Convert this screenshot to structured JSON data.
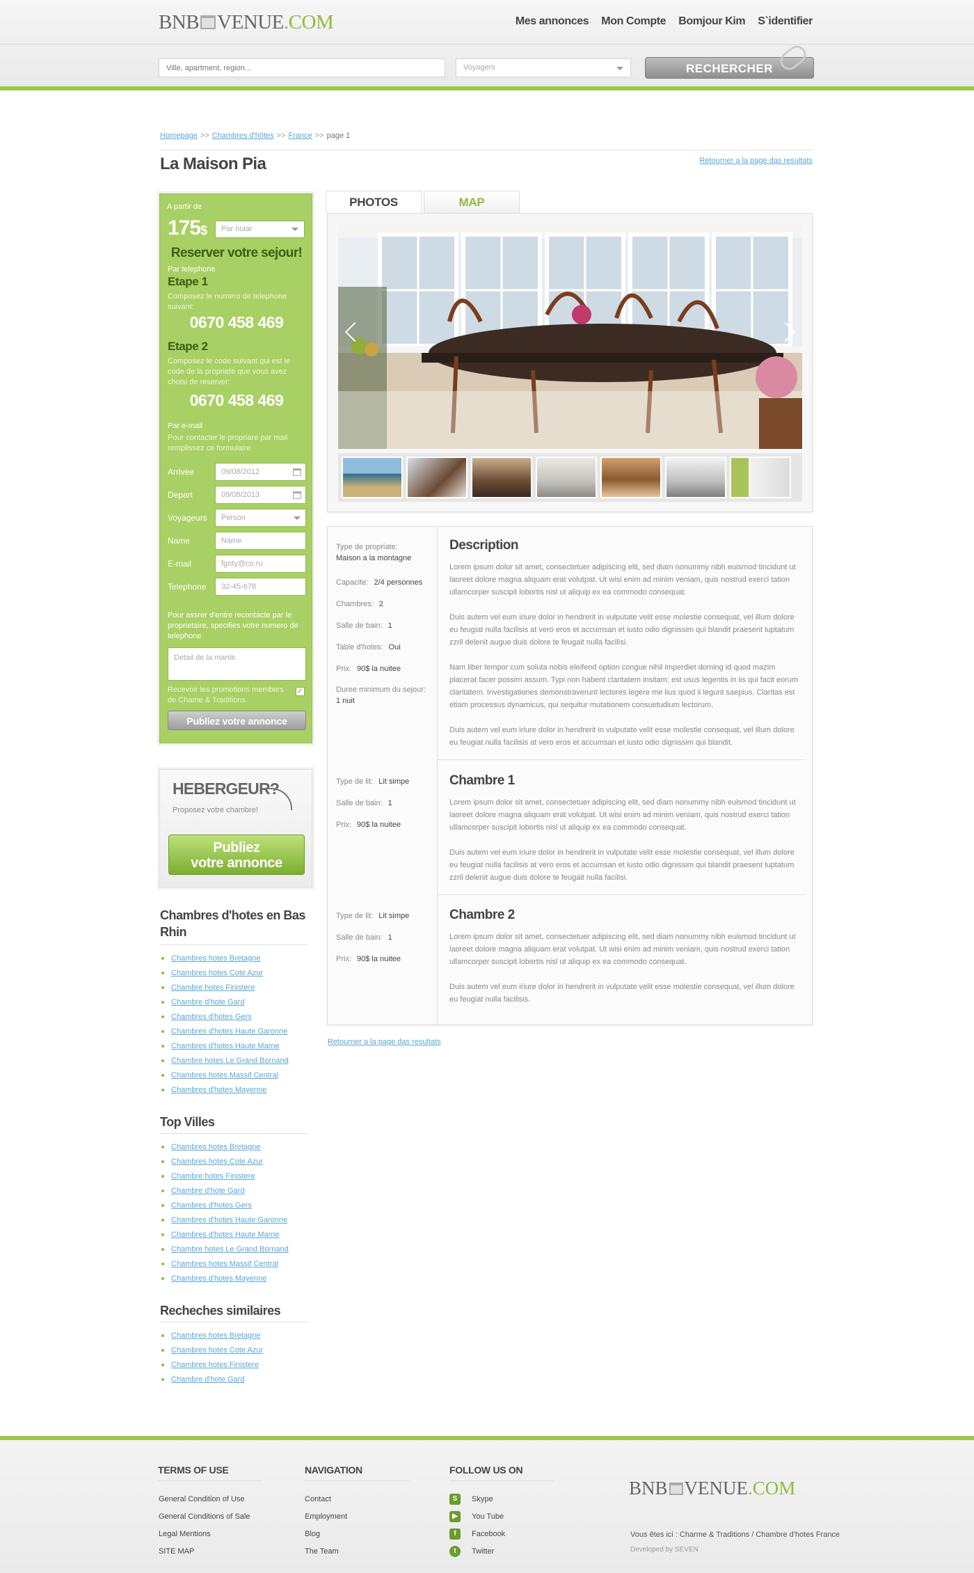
{
  "header": {
    "logo_left": "BNB",
    "logo_right": "VENUE",
    "logo_tld": ".COM",
    "nav": [
      "Mes annonces",
      "Mon Compte",
      "Bomjour Kim",
      "S`identifier"
    ],
    "search_placeholder": "Ville, apartment, region...",
    "voyagers_select": "Voyagers",
    "search_button": "RECHERCHER"
  },
  "breadcrumb": {
    "items": [
      "Homepage",
      "Chambres d'hôtes",
      "France"
    ],
    "separator": ">>",
    "current": "page 1"
  },
  "title": "La Maison Pia",
  "return_link": "Retourner a la page das resultats",
  "booking": {
    "from_label": "A partir de",
    "price": "175",
    "currency": "$",
    "per_select": "Par nuiar",
    "reserve_title": "Reserver votre sejour!",
    "by_phone": "Par telephone",
    "step1_title": "Etape 1",
    "step1_text": "Composez le numero de telephone suivant:",
    "step1_phone": "0670 458 469",
    "step2_title": "Etape 2",
    "step2_text": "Composez le code suivant qui est le code de la propriete que vous avez choisi de reserver:",
    "step2_code": "0670 458 469",
    "by_email": "Par e-mail",
    "email_text": "Pour contacter le propriare par mail remplissez ce formulaire",
    "fields": [
      {
        "label": "Arrivee",
        "value": "09/08/2012",
        "type": "date"
      },
      {
        "label": "Depart",
        "value": "09/08/2013",
        "type": "date"
      },
      {
        "label": "Voyageurs",
        "value": "Person",
        "type": "select"
      },
      {
        "label": "Name",
        "value": "Name",
        "type": "text"
      },
      {
        "label": "E-mail",
        "value": "fgoty@co.ru",
        "type": "text"
      },
      {
        "label": "Telephone",
        "value": "32-45-678",
        "type": "text"
      }
    ],
    "contact_note": "Pour assrer d'entre recontacte par le proprietaire, specifies votre numero de telephone",
    "detail_placeholder": "Detail de la mante",
    "promo_text": "Recevoir les promotions members de Chame & Traditions",
    "promo_checked": true,
    "publish_button": "Publiez votre annonce"
  },
  "hebergeur": {
    "title": "HEBERGEUR?",
    "subtitle": "Proposez votre chambre!",
    "button_line1": "Publiez",
    "button_line2": "votre annonce"
  },
  "sidebar": {
    "section1": {
      "title": "Chambres d'hotes en Bas Rhin",
      "items": [
        "Chambres hotes Bretagne",
        "Chambres hotes Cote Azur",
        "Chambre hotes Finistere",
        "Chambre d'hote Gard",
        "Chambres d'hotes Gers",
        "Chambres d'hotes Haute Garonne",
        "Chambres d'hotes Haute Marne",
        "Chambre hotes Le Grand Bornand",
        "Chambres hotes Massif Central",
        "Chambres d'hotes Mayenne"
      ]
    },
    "section2": {
      "title": "Top Villes",
      "items": [
        "Chambres hotes Bretagne",
        "Chambres hotes Cote Azur",
        "Chambre hotes Finistere",
        "Chambre d'hote Gard",
        "Chambres d'hotes Gers",
        "Chambres d'hotes Haute Garonne",
        "Chambres d'hotes Haute Marne",
        "Chambre hotes Le Grand Bornand",
        "Chambres hotes Massif Central",
        "Chambres d'hotes Mayenne"
      ]
    },
    "section3": {
      "title": "Recheches similaires",
      "items": [
        "Chambres hotes Bretagne",
        "Chambres hotes Cote Azur",
        "Chambres hotes Finistere",
        "Chambre d'hote Gard"
      ]
    }
  },
  "tabs": [
    "PHOTOS",
    "MAP"
  ],
  "details": {
    "props": [
      {
        "label": "Type de propriate:",
        "value": "Maison a la montagne"
      },
      {
        "label": "Capacite:",
        "value": "2/4 personnes"
      },
      {
        "label": "Chambres:",
        "value": "2"
      },
      {
        "label": "Salle de bain:",
        "value": "1"
      },
      {
        "label": "Table d'hotes:",
        "value": "Oui"
      },
      {
        "label": "Prix:",
        "value": "90$ la nuitee"
      },
      {
        "label": "Duree minimum du sejour:",
        "value": "1 nuit"
      }
    ],
    "description_title": "Description",
    "description_paras": [
      "Lorem ipsum dolor sit amet, consectetuer adipiscing elit, sed diam nonummy nibh euismod tincidunt ut laoreet dolore magna aliquam erat volutpat. Ut wisi enim ad minim veniam, quis nostrud exerci tation ullamcorper suscipit lobortis nisl ut aliquip ex ea commodo consequat.",
      "Duis autem vel eum iriure dolor in hendrerit in vulputate velit esse molestie consequat, vel illum dolore eu feugiat nulla facilisis at vero eros et accumsan et iusto odio dignissim qui blandit praesent luptatum zzril delenit augue duis dolore te feugait nulla facilisi.",
      "Nam liber tempor cum soluta nobis eleifend option congue nihil imperdiet doming id quod mazim placerat facer possim assum. Typi non habent claritatem insitam; est usus legentis in iis qui facit eorum claritatem. Investigationes demonstraverunt lectores legere me lius quod ii legunt saepius. Claritas est etiam processus dynamicus, qui sequitur mutationem consuetudium lectorum.",
      "Duis autem vel eum iriure dolor in hendrerit in vulputate velit esse molestie consequat, vel illum dolore eu feugiat nulla facilisis at vero eros et accumsan et iusto odio dignissim qui blandit."
    ],
    "rooms": [
      {
        "title": "Chambre 1",
        "props": [
          {
            "label": "Type de lit:",
            "value": "Lit simpe"
          },
          {
            "label": "Salle de bain:",
            "value": "1"
          },
          {
            "label": "Prix:",
            "value": "90$ la nuitee"
          }
        ],
        "paras": [
          "Lorem ipsum dolor sit amet, consectetuer adipiscing elit, sed diam nonummy nibh euismod tincidunt ut laoreet dolore magna aliquam erat volutpat. Ut wisi enim ad minim veniam, quis nostrud exerci tation ullamcorper suscipit lobortis nisl ut aliquip ex ea commodo consequat.",
          "Duis autem vel eum iriure dolor in hendrerit in vulputate velit esse molestie consequat, vel illum dolore eu feugiat nulla facilisis at vero eros et accumsan et iusto odio dignissim qui blandit praesent luptatum zzril delenit augue duis dolore te feugait nulla facilisi."
        ]
      },
      {
        "title": "Chambre 2",
        "props": [
          {
            "label": "Type de lit:",
            "value": "Lit simpe"
          },
          {
            "label": "Salle de bain:",
            "value": "1"
          },
          {
            "label": "Prix:",
            "value": "90$ la nuitee"
          }
        ],
        "paras": [
          "Lorem ipsum dolor sit amet, consectetuer adipiscing elit, sed diam nonummy nibh euismod tincidunt ut laoreet dolore magna aliquam erat volutpat. Ut wisi enim ad minim veniam, quis nostrud exerci tation ullamcorper suscipit lobortis nisl ut aliquip ex ea commodo consequat.",
          "Duis autem vel eum iriure dolor in hendrerit in vulputate velit esse molestie consequat, vel illum dolore eu feugiat nulla facilisis."
        ]
      }
    ]
  },
  "footer": {
    "terms": {
      "title": "TERMS OF USE",
      "links": [
        "General Condition of Use",
        "General Conditions of Sale",
        "Legal Mentions",
        "SITE MAP"
      ]
    },
    "navigation": {
      "title": "NAVIGATION",
      "links": [
        "Contact",
        "Employment",
        "Blog",
        "The Team"
      ]
    },
    "follow": {
      "title": "FOLLOW US ON",
      "links": [
        "Skype",
        "You Tube",
        "Facebook",
        "Twitter"
      ]
    },
    "logo_left": "BNB",
    "logo_right": "VENUE",
    "logo_tld": ".COM",
    "location": "Vous êtes ici : Charme & Traditions / Chambre d'hotes France",
    "developed": "Developed by SEVEN"
  },
  "colors": {
    "accent_green": "#9cc84a",
    "link_blue": "#5aa6d6",
    "dark_green_text": "#3f5d12"
  }
}
